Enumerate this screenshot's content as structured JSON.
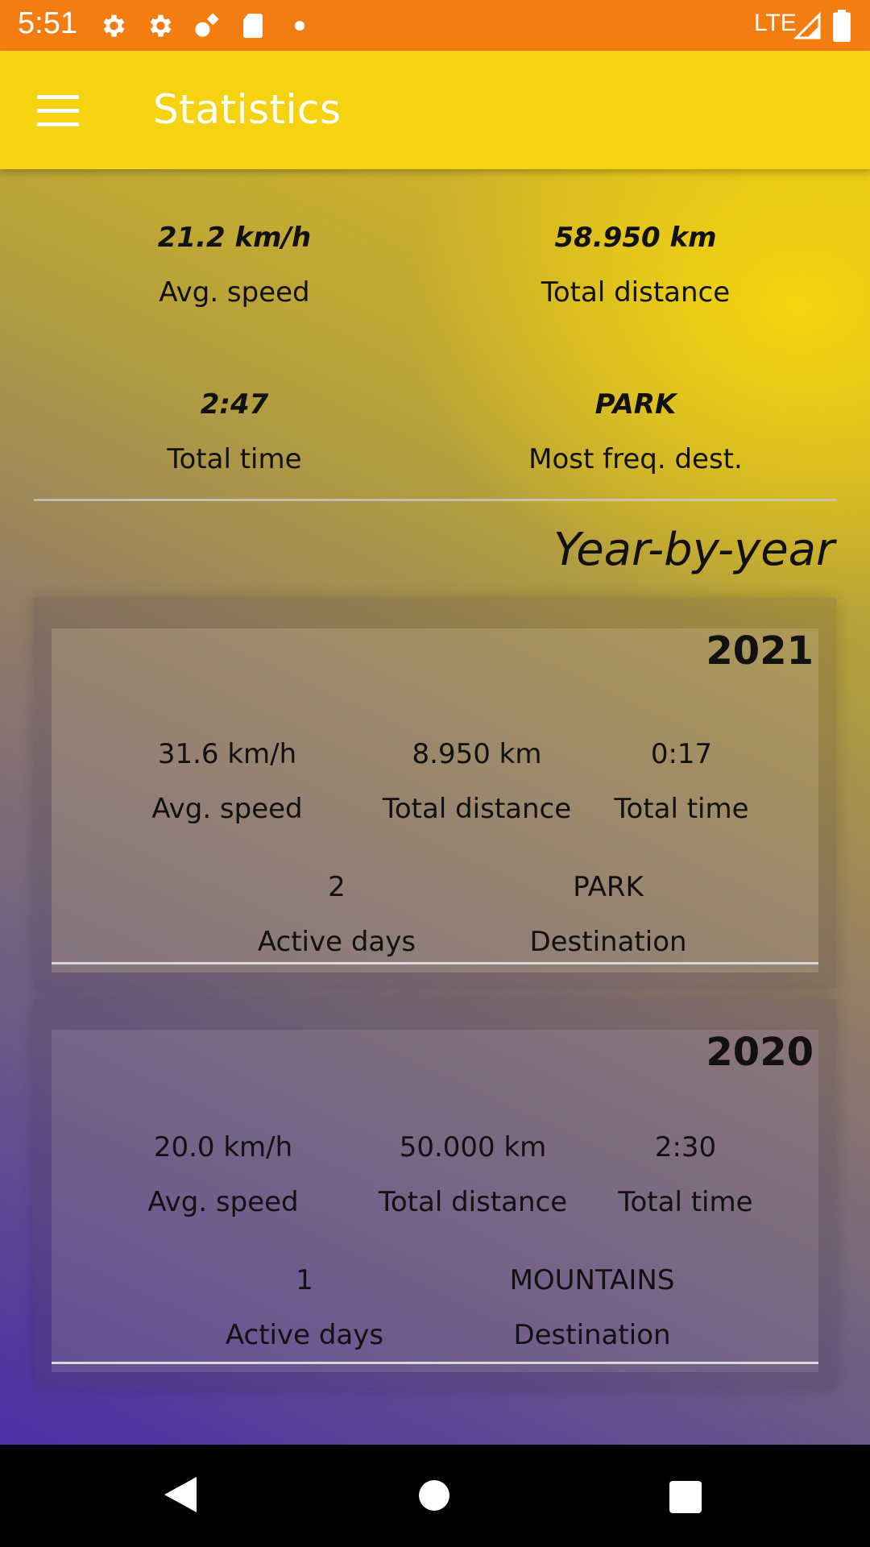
{
  "status_bar": {
    "time": "5:51",
    "network": "LTE",
    "icons": [
      "gear-icon",
      "gear-icon",
      "satellite-icon",
      "sd-card-icon",
      "dot-icon",
      "signal-icon",
      "battery-icon"
    ]
  },
  "app_bar": {
    "title": "Statistics",
    "menu_icon": "hamburger-menu-icon"
  },
  "summary": {
    "avg_speed": {
      "value": "21.2 km/h",
      "label": "Avg. speed"
    },
    "total_distance": {
      "value": "58.950 km",
      "label": "Total distance"
    },
    "total_time": {
      "value": "2:47",
      "label": "Total time"
    },
    "most_freq_dest": {
      "value": "PARK",
      "label": "Most freq. dest."
    }
  },
  "year_by_year": {
    "heading": "Year-by-year",
    "years": [
      {
        "year": "2021",
        "avg_speed": {
          "value": "31.6 km/h",
          "label": "Avg. speed"
        },
        "total_distance": {
          "value": "8.950 km",
          "label": "Total distance"
        },
        "total_time": {
          "value": "0:17",
          "label": "Total time"
        },
        "active_days": {
          "value": "2",
          "label": "Active days"
        },
        "destination": {
          "value": "PARK",
          "label": "Destination"
        }
      },
      {
        "year": "2020",
        "avg_speed": {
          "value": "20.0 km/h",
          "label": "Avg. speed"
        },
        "total_distance": {
          "value": "50.000 km",
          "label": "Total distance"
        },
        "total_time": {
          "value": "2:30",
          "label": "Total time"
        },
        "active_days": {
          "value": "1",
          "label": "Active days"
        },
        "destination": {
          "value": "MOUNTAINS",
          "label": "Destination"
        }
      }
    ]
  },
  "nav_bar": {
    "icons": [
      "back-icon",
      "home-icon",
      "recents-icon"
    ]
  },
  "colors": {
    "status_bar": "#f47d11",
    "app_bar": "#f6d311",
    "gradient_top": "#f5d40f",
    "gradient_bottom": "#4a2fa6"
  }
}
